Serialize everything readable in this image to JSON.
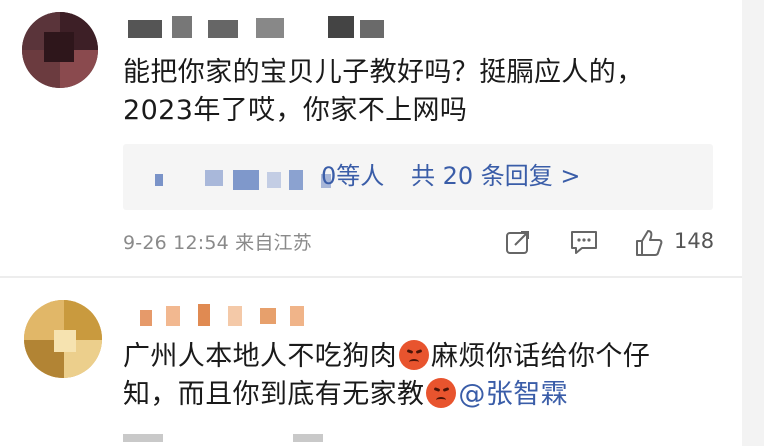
{
  "comments": [
    {
      "text_line1": "能把你家的宝贝儿子教好吗？挺膈应人的，",
      "text_line2": "2023年了哎，你家不上网吗",
      "reply_tail": "0等人",
      "reply_more": "共 20 条回复 >",
      "meta": "9-26 12:54 来自江苏",
      "like_count": "148",
      "icons": [
        "share-icon",
        "comment-icon",
        "like-icon"
      ]
    },
    {
      "text_line1_a": "广州人本地人不吃狗肉",
      "text_line1_b": "麻烦你话给你个仔",
      "text_line2_a": "知，而且你到底有无家教",
      "mention": "@张智霖",
      "icons": [
        "angry-face-emoji",
        "angry-face-emoji"
      ]
    }
  ],
  "colors": {
    "link_blue": "#3a5da8",
    "meta_gray": "#8a8a8a",
    "reply_bg": "#f5f5f5",
    "emoji_red": "#e8542e"
  }
}
